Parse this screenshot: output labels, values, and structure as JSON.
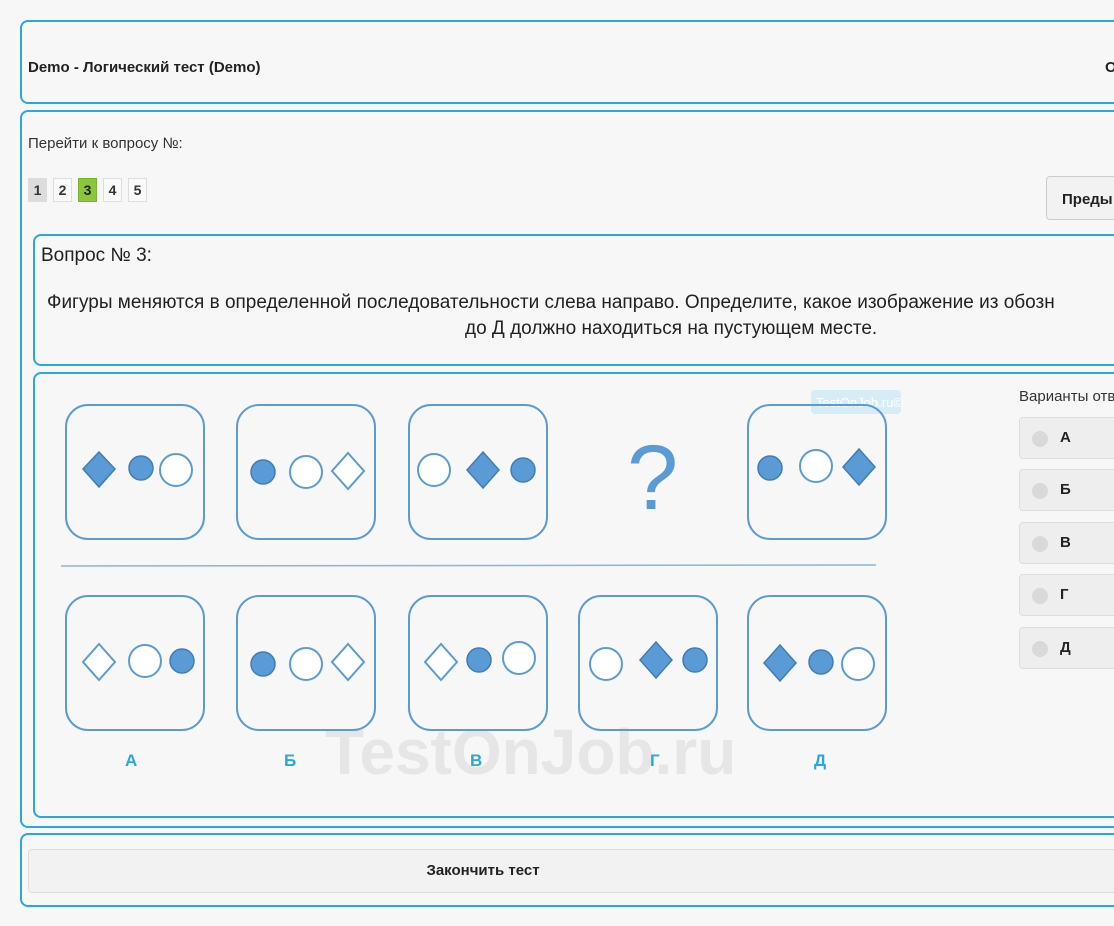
{
  "header": {
    "title": "Demo - Логический тест (Demo)",
    "right_text": "О"
  },
  "navigation": {
    "goto_label": "Перейти к вопросу №:",
    "questions": [
      "1",
      "2",
      "3",
      "4",
      "5"
    ],
    "current": "3",
    "prev_label": "Преды"
  },
  "question": {
    "label": "Вопрос № 3:",
    "text_line1": "Фигуры меняются в определенной последовательности слева направо. Определите, какое изображение из обозн",
    "text_line2": "до Д должно находиться на пустующем месте."
  },
  "figure": {
    "watermark_small": "TestOnJob.ru©",
    "watermark_large": "TestOnJob.ru",
    "missing_mark": "?",
    "option_letters": [
      "А",
      "Б",
      "В",
      "Г",
      "Д"
    ]
  },
  "answers": {
    "label": "Варианты отв",
    "options": [
      "А",
      "Б",
      "В",
      "Г",
      "Д"
    ]
  },
  "footer": {
    "finish_label": "Закончить тест"
  },
  "colors": {
    "accent_border": "#29a8e0",
    "current_question": "#8cc63f",
    "shape_fill": "#5b9bd5",
    "option_letter": "#29a8e0"
  }
}
